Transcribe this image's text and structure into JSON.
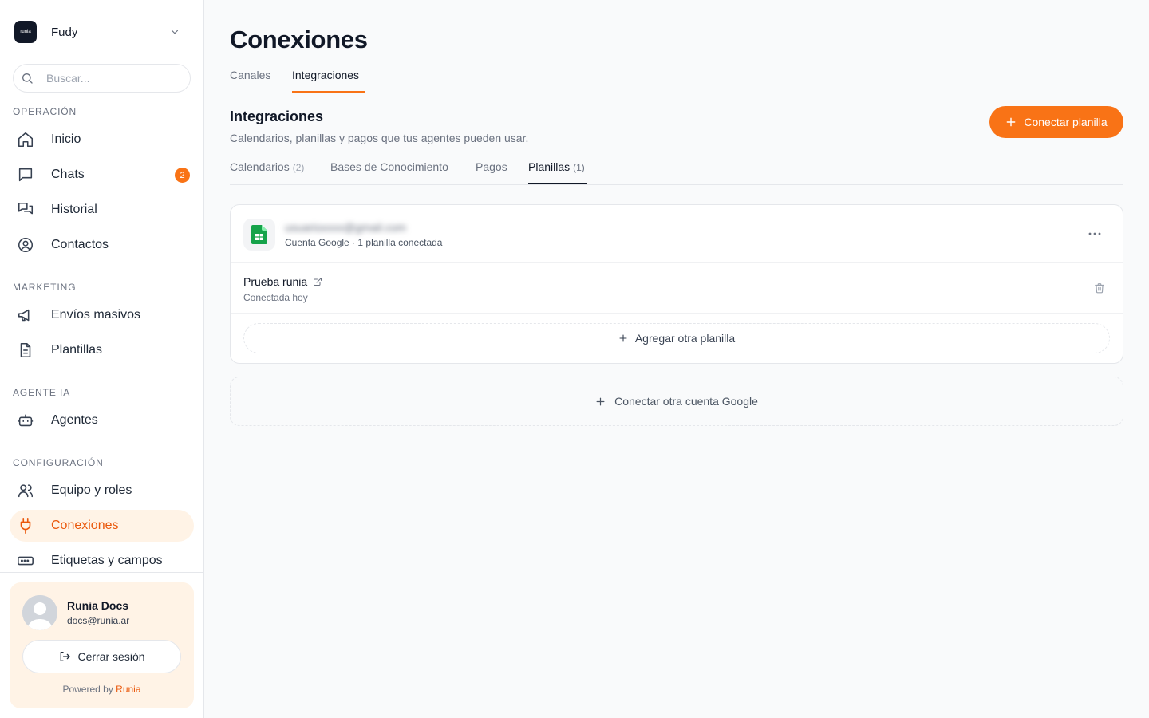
{
  "workspace": {
    "name": "Fudy",
    "logo_text": "runia",
    "logo_icon": "runia-logo-icon"
  },
  "search": {
    "placeholder": "Buscar..."
  },
  "sidebar": {
    "sections": [
      {
        "title": "OPERACIÓN",
        "items": [
          {
            "label": "Inicio",
            "icon": "home-icon"
          },
          {
            "label": "Chats",
            "icon": "chat-bubble-icon",
            "badge": "2"
          },
          {
            "label": "Historial",
            "icon": "history-chats-icon"
          },
          {
            "label": "Contactos",
            "icon": "user-circle-icon"
          }
        ]
      },
      {
        "title": "MARKETING",
        "items": [
          {
            "label": "Envíos masivos",
            "icon": "megaphone-icon"
          },
          {
            "label": "Plantillas",
            "icon": "document-icon"
          }
        ]
      },
      {
        "title": "AGENTE IA",
        "items": [
          {
            "label": "Agentes",
            "icon": "bot-icon"
          }
        ]
      },
      {
        "title": "CONFIGURACIÓN",
        "items": [
          {
            "label": "Equipo y roles",
            "icon": "users-icon"
          },
          {
            "label": "Conexiones",
            "icon": "plug-icon",
            "active": true
          },
          {
            "label": "Etiquetas y campos",
            "icon": "tag-field-icon"
          }
        ]
      }
    ]
  },
  "user": {
    "name": "Runia Docs",
    "email": "docs@runia.ar",
    "logout_label": "Cerrar sesión",
    "powered_prefix": "Powered by",
    "powered_brand": "Runia"
  },
  "page": {
    "title": "Conexiones",
    "tabs": [
      {
        "label": "Canales"
      },
      {
        "label": "Integraciones",
        "active": true
      }
    ],
    "section": {
      "title": "Integraciones",
      "description": "Calendarios, planillas y pagos que tus agentes pueden usar.",
      "connect_button": "Conectar planilla"
    },
    "sub_tabs": [
      {
        "label": "Calendarios",
        "count": "(2)"
      },
      {
        "label": "Bases de Conocimiento",
        "count": ""
      },
      {
        "label": "Pagos",
        "count": ""
      },
      {
        "label": "Planillas",
        "count": "(1)",
        "active": true
      }
    ],
    "account": {
      "email": "usuarioxxxx@gmail.com",
      "meta": "Cuenta Google · 1 planilla conectada",
      "sheets": [
        {
          "name": "Prueba runia",
          "status": "Conectada hoy"
        }
      ],
      "add_sheet_label": "Agregar otra planilla"
    },
    "connect_google_label": "Conectar otra cuenta Google"
  },
  "colors": {
    "accent": "#f97316",
    "accent_text": "#ea580c",
    "active_bg": "#fff3e6",
    "sheets_green": "#16a34a"
  }
}
